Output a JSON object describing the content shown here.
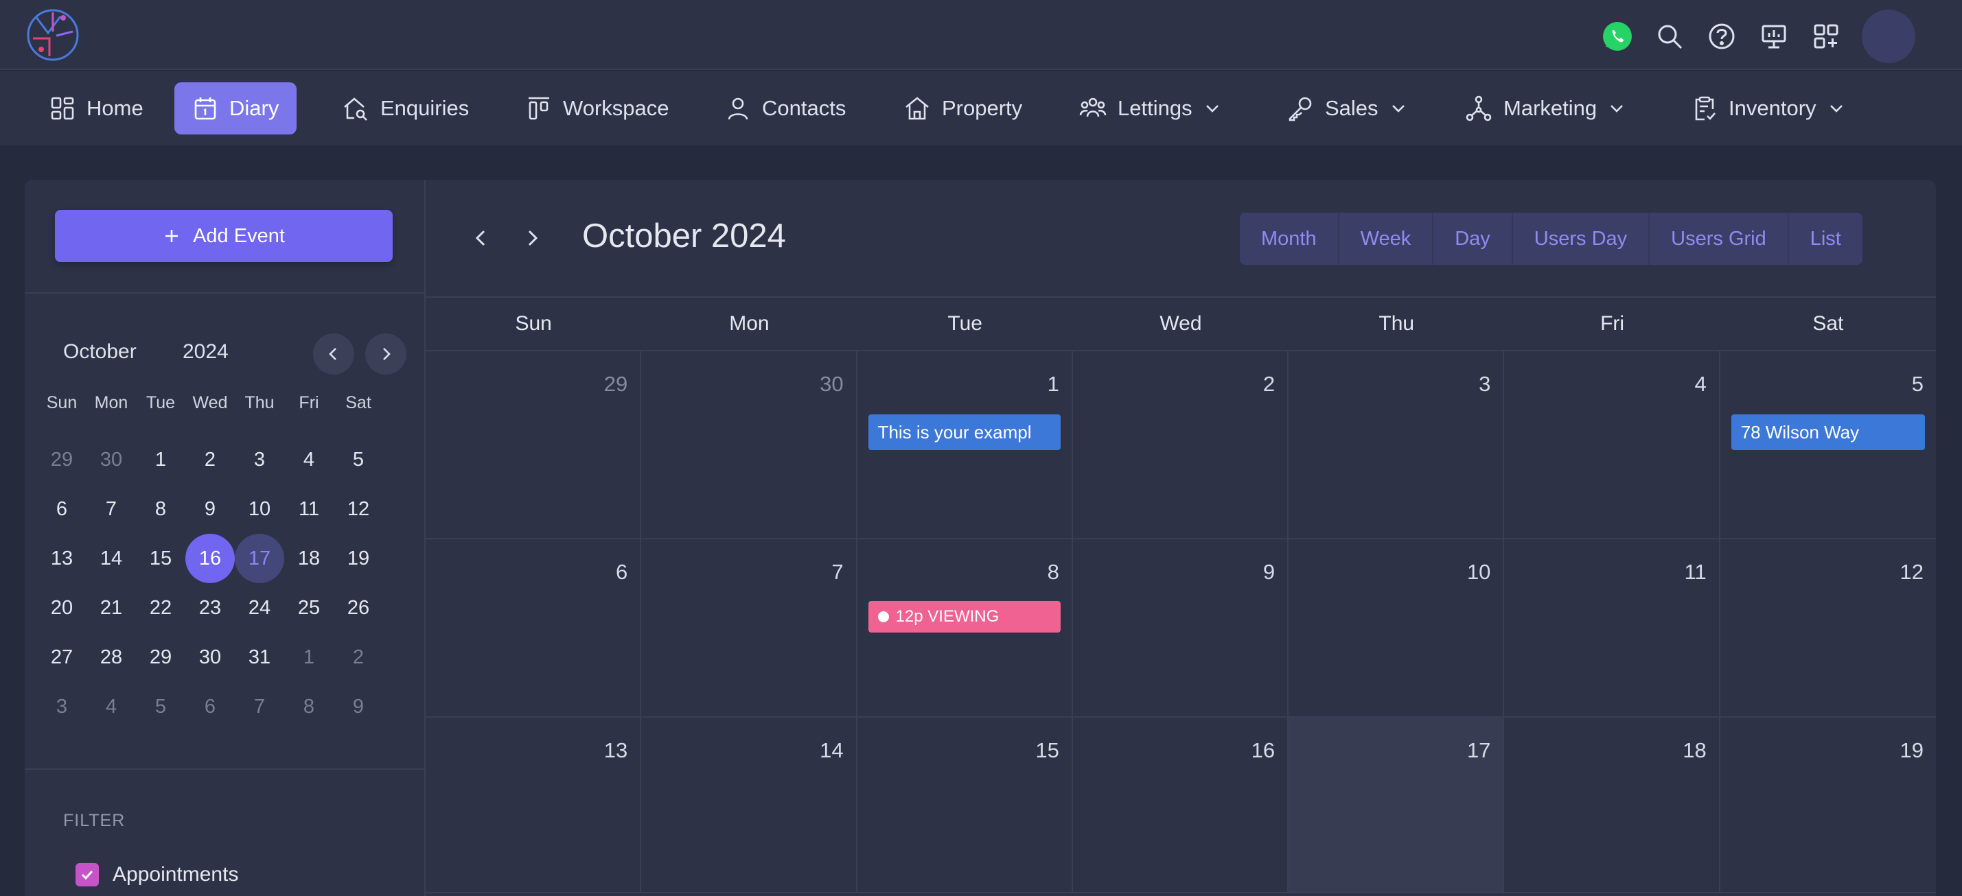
{
  "nav": {
    "items": [
      {
        "label": "Home",
        "icon": "home-grid-icon",
        "active": false,
        "dropdown": false
      },
      {
        "label": "Diary",
        "icon": "calendar-icon",
        "active": true,
        "dropdown": false
      },
      {
        "label": "Enquiries",
        "icon": "house-search-icon",
        "active": false,
        "dropdown": false
      },
      {
        "label": "Workspace",
        "icon": "workspace-icon",
        "active": false,
        "dropdown": false
      },
      {
        "label": "Contacts",
        "icon": "user-icon",
        "active": false,
        "dropdown": false
      },
      {
        "label": "Property",
        "icon": "house-icon",
        "active": false,
        "dropdown": false
      },
      {
        "label": "Lettings",
        "icon": "people-icon",
        "active": false,
        "dropdown": true
      },
      {
        "label": "Sales",
        "icon": "key-icon",
        "active": false,
        "dropdown": true
      },
      {
        "label": "Marketing",
        "icon": "network-icon",
        "active": false,
        "dropdown": true
      },
      {
        "label": "Inventory",
        "icon": "clipboard-check-icon",
        "active": false,
        "dropdown": true
      }
    ]
  },
  "sidebar": {
    "add_event_label": "Add Event",
    "mini_calendar": {
      "month": "October",
      "year": "2024",
      "weekdays": [
        "Sun",
        "Mon",
        "Tue",
        "Wed",
        "Thu",
        "Fri",
        "Sat"
      ],
      "days": [
        {
          "d": "29",
          "muted": true
        },
        {
          "d": "30",
          "muted": true
        },
        {
          "d": "1"
        },
        {
          "d": "2"
        },
        {
          "d": "3"
        },
        {
          "d": "4"
        },
        {
          "d": "5"
        },
        {
          "d": "6"
        },
        {
          "d": "7"
        },
        {
          "d": "8"
        },
        {
          "d": "9"
        },
        {
          "d": "10"
        },
        {
          "d": "11"
        },
        {
          "d": "12"
        },
        {
          "d": "13"
        },
        {
          "d": "14"
        },
        {
          "d": "15"
        },
        {
          "d": "16",
          "selected": true
        },
        {
          "d": "17",
          "today": true
        },
        {
          "d": "18"
        },
        {
          "d": "19"
        },
        {
          "d": "20"
        },
        {
          "d": "21"
        },
        {
          "d": "22"
        },
        {
          "d": "23"
        },
        {
          "d": "24"
        },
        {
          "d": "25"
        },
        {
          "d": "26"
        },
        {
          "d": "27"
        },
        {
          "d": "28"
        },
        {
          "d": "29"
        },
        {
          "d": "30"
        },
        {
          "d": "31"
        },
        {
          "d": "1",
          "muted": true
        },
        {
          "d": "2",
          "muted": true
        },
        {
          "d": "3",
          "muted": true
        },
        {
          "d": "4",
          "muted": true
        },
        {
          "d": "5",
          "muted": true
        },
        {
          "d": "6",
          "muted": true
        },
        {
          "d": "7",
          "muted": true
        },
        {
          "d": "8",
          "muted": true
        },
        {
          "d": "9",
          "muted": true
        }
      ]
    },
    "filter_label": "FILTER",
    "filters": [
      {
        "label": "Appointments",
        "checked": true
      }
    ]
  },
  "calendar": {
    "title": "October 2024",
    "views": [
      "Month",
      "Week",
      "Day",
      "Users Day",
      "Users Grid",
      "List"
    ],
    "weekdays": [
      "Sun",
      "Mon",
      "Tue",
      "Wed",
      "Thu",
      "Fri",
      "Sat"
    ],
    "weeks": [
      [
        {
          "d": "29",
          "muted": true
        },
        {
          "d": "30",
          "muted": true
        },
        {
          "d": "1",
          "event": {
            "text": "This is your exampl",
            "color": "blue"
          }
        },
        {
          "d": "2"
        },
        {
          "d": "3"
        },
        {
          "d": "4"
        },
        {
          "d": "5",
          "event": {
            "text": "78 Wilson Way",
            "color": "blue"
          }
        }
      ],
      [
        {
          "d": "6"
        },
        {
          "d": "7"
        },
        {
          "d": "8",
          "event": {
            "text": "12p VIEWING",
            "color": "pink",
            "dot": true
          }
        },
        {
          "d": "9"
        },
        {
          "d": "10"
        },
        {
          "d": "11"
        },
        {
          "d": "12"
        }
      ],
      [
        {
          "d": "13"
        },
        {
          "d": "14"
        },
        {
          "d": "15"
        },
        {
          "d": "16"
        },
        {
          "d": "17",
          "today": true
        },
        {
          "d": "18"
        },
        {
          "d": "19"
        }
      ]
    ]
  },
  "colors": {
    "accent": "#7166ef",
    "event_blue": "#3c78d8",
    "event_pink": "#f06292",
    "whatsapp": "#25d366"
  },
  "top_icons": [
    "whatsapp-icon",
    "search-icon",
    "help-icon",
    "presentation-icon",
    "apps-add-icon"
  ]
}
